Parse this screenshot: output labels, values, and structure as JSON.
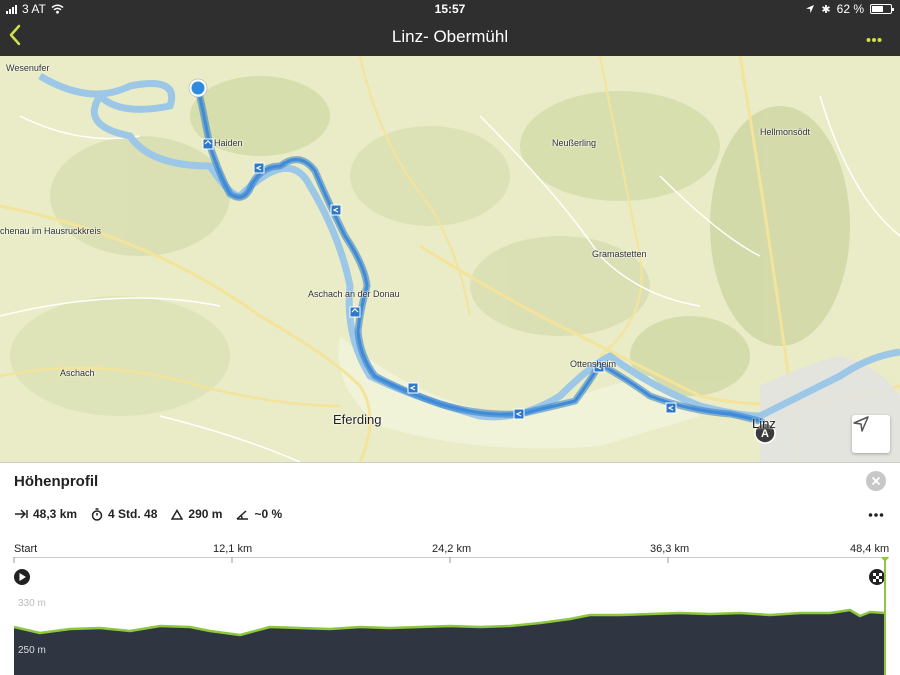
{
  "status_bar": {
    "carrier": "3 AT",
    "time": "15:57",
    "battery": "62 %",
    "battery_level": 0.62
  },
  "nav": {
    "title": "Linz- Obermühl",
    "back_icon": "chevron-left-icon",
    "more_icon": "ellipsis-icon"
  },
  "colors": {
    "bar": "#2f2f2f",
    "accent": "#cfe04a",
    "route": "#3d8bd9",
    "profile_fill": "#2f3641",
    "profile_line": "#8dc63f",
    "map_bg": "#e9ecc6"
  },
  "map": {
    "labels": {
      "wesenufer": "Wesenufer",
      "haiden": "Haiden",
      "neusserling": "Neußerling",
      "hellmonsoedt": "Hellmonsödt",
      "hausruckkreis": "chenau im Hausruckkreis",
      "gramastetten": "Gramastetten",
      "aschach_donau": "Aschach an der Donau",
      "aschach": "Aschach",
      "ottensheim": "Ottensheim",
      "eferding": "Eferding",
      "linz": "Linz"
    },
    "end_marker": "A"
  },
  "profile": {
    "title": "Höhenprofil",
    "distance": "48,3 km",
    "duration": "4 Std. 48",
    "ascent": "290 m",
    "gradient": "~0 %",
    "axis": [
      "Start",
      "12,1 km",
      "24,2 km",
      "36,3 km",
      "48,4 km"
    ],
    "y_labels": {
      "top": "330 m",
      "bottom": "250 m"
    }
  }
}
